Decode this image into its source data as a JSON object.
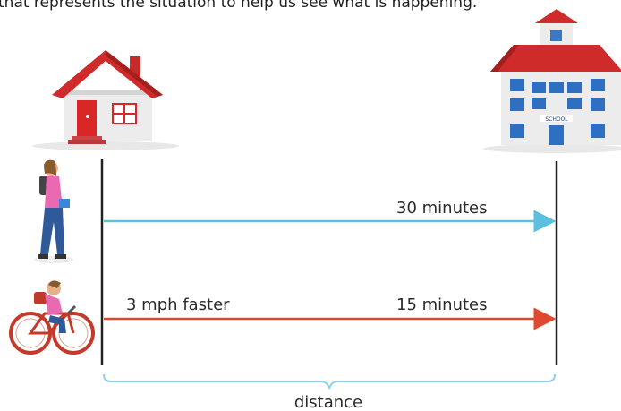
{
  "caption": "that represents the situation to help us see what is happening.",
  "labels": {
    "walk_time": "30 minutes",
    "bike_speed": "3 mph faster",
    "bike_time": "15 minutes",
    "distance": "distance",
    "school_sign": "SCHOOL"
  },
  "colors": {
    "walk_arrow": "#5bbfe0",
    "bike_arrow": "#e0492e",
    "brace": "#8fd0ea",
    "vertical_lines": "#222222"
  },
  "icons": [
    "house-icon",
    "school-icon",
    "walker-icon",
    "cyclist-icon"
  ]
}
